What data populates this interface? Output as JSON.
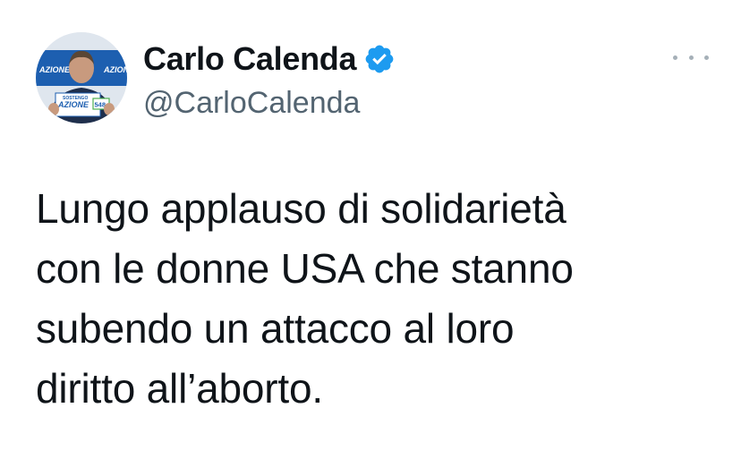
{
  "author": {
    "display_name": "Carlo Calenda",
    "handle": "@CarloCalenda",
    "verified": true,
    "avatar_banner_text": "AZIONE",
    "avatar_sign_top": "SOSTENGO",
    "avatar_sign_main": "AZIONE",
    "avatar_sign_number": "548"
  },
  "tweet": {
    "lines": [
      "Lungo applauso di solidarietà",
      "con le donne USA che stanno",
      "subendo un attacco al loro",
      "diritto all’aborto."
    ]
  },
  "icons": {
    "verified": "verified-badge-icon",
    "more": "more-options-icon"
  },
  "colors": {
    "verified_blue": "#1d9bf0",
    "handle_gray": "#536471",
    "text": "#0f1419"
  }
}
